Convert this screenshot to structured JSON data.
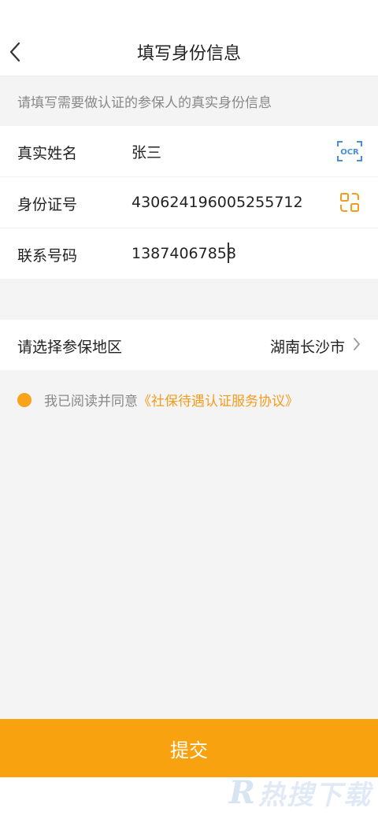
{
  "header": {
    "title": "填写身份信息",
    "back_icon": "chevron-left-icon"
  },
  "hint": "请填写需要做认证的参保人的真实身份信息",
  "form": {
    "name": {
      "label": "真实姓名",
      "value": "张三",
      "icon": "ocr-scan-icon",
      "icon_text": "OCR"
    },
    "id_number": {
      "label": "身份证号",
      "value": "430624196005255712",
      "icon": "scan-icon"
    },
    "phone": {
      "label": "联系号码",
      "value": "13874067858"
    }
  },
  "region": {
    "label": "请选择参保地区",
    "value": "湖南长沙市",
    "icon": "chevron-right-icon"
  },
  "agreement": {
    "prefix": "我已阅读并同意",
    "link": "《社保待遇认证服务协议》",
    "checked": true
  },
  "submit_label": "提交",
  "watermark": {
    "letter": "R",
    "text": "热搜下载"
  },
  "colors": {
    "accent": "#f7a20e",
    "link": "#f29c1f",
    "icon_blue": "#4a8fd6"
  }
}
